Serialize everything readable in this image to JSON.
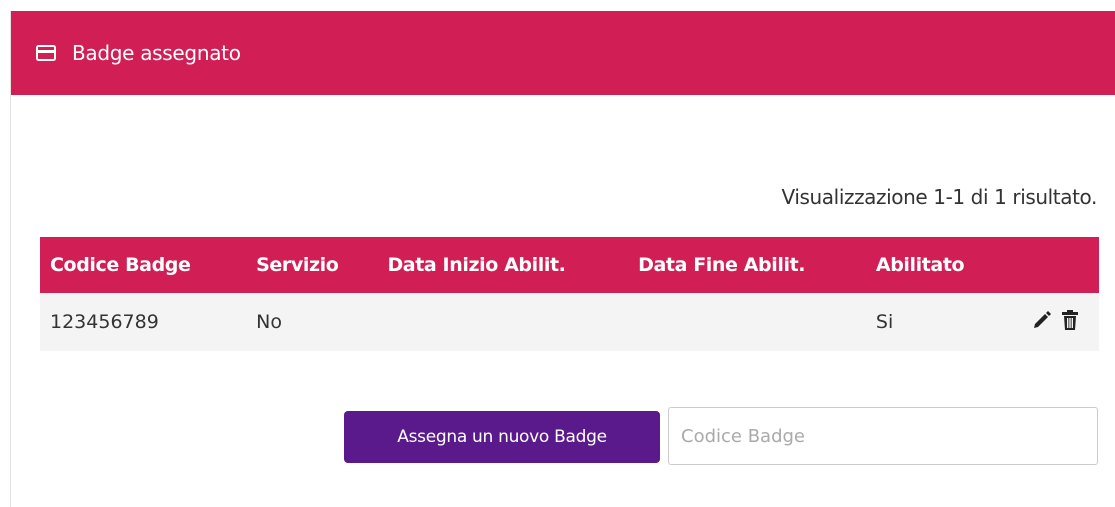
{
  "header": {
    "title": "Badge assegnato",
    "icon": "credit-card-icon",
    "color": "#d11f55"
  },
  "summary": "Visualizzazione 1-1 di 1 risultato.",
  "table": {
    "columns": [
      "Codice Badge",
      "Servizio",
      "Data Inizio Abilit.",
      "Data Fine Abilit.",
      "Abilitato",
      ""
    ],
    "rows": [
      {
        "code": "123456789",
        "service": "No",
        "start": "",
        "end": "",
        "enabled": "Si",
        "actions": [
          "pencil-icon",
          "trash-icon"
        ]
      }
    ]
  },
  "form": {
    "button_label": "Assegna un nuovo Badge",
    "button_color": "#5b1a8b",
    "input_placeholder": "Codice Badge",
    "input_value": ""
  }
}
